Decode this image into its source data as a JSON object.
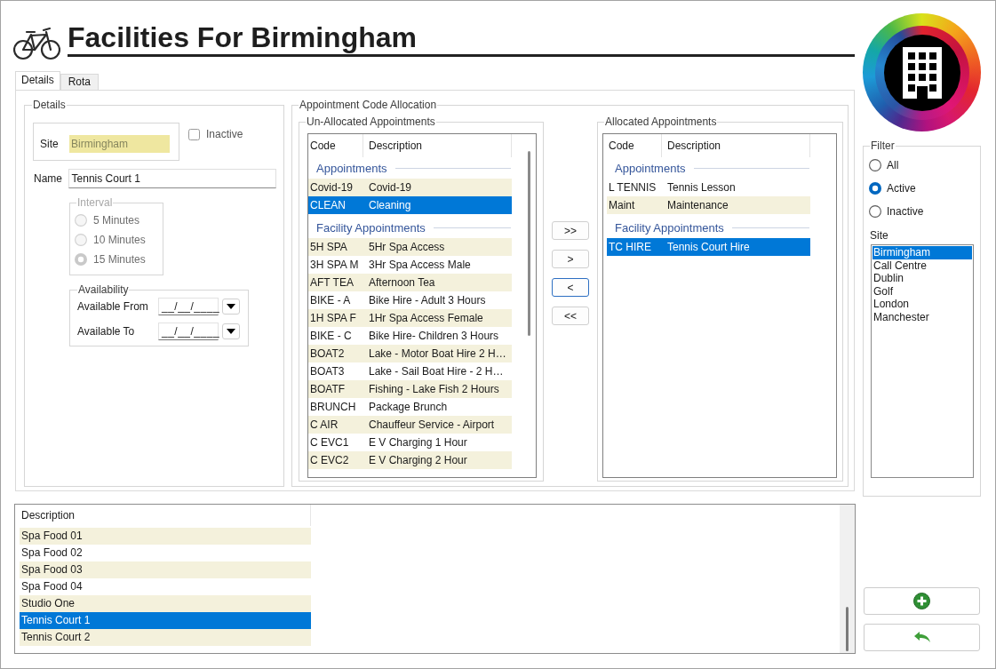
{
  "header": {
    "title": "Facilities For Birmingham"
  },
  "tabs": [
    {
      "label": "Details",
      "selected": true
    },
    {
      "label": "Rota",
      "selected": false
    }
  ],
  "details": {
    "legend": "Details",
    "site": {
      "label": "Site",
      "value": "Birmingham"
    },
    "inactive": {
      "label": "Inactive",
      "checked": false
    },
    "name": {
      "label": "Name",
      "value": "Tennis Court 1"
    },
    "interval": {
      "legend": "Interval",
      "disabled": true,
      "options": [
        {
          "label": "5 Minutes",
          "selected": false
        },
        {
          "label": "10 Minutes",
          "selected": false
        },
        {
          "label": "15 Minutes",
          "selected": true
        }
      ]
    },
    "availability": {
      "legend": "Availability",
      "fields": [
        {
          "label": "Available From",
          "value": "__/__/____"
        },
        {
          "label": "Available To",
          "value": "__/__/____"
        }
      ]
    }
  },
  "allocation": {
    "legend": "Appointment Code Allocation",
    "unallocated": {
      "legend": "Un-Allocated Appointments",
      "columns": [
        "Code",
        "Description"
      ],
      "groups": [
        {
          "title": "Appointments",
          "rows": [
            {
              "code": "Covid-19",
              "description": "Covid-19",
              "shaded": true,
              "selected": false
            },
            {
              "code": "CLEAN",
              "description": "Cleaning",
              "selected": true
            }
          ]
        },
        {
          "title": "Facility Appointments",
          "rows": [
            {
              "code": "5H SPA",
              "description": "5Hr Spa Access",
              "shaded": true,
              "selected": false
            },
            {
              "code": "3H SPA M",
              "description": "3Hr Spa Access Male",
              "shaded": false,
              "selected": false
            },
            {
              "code": "AFT TEA",
              "description": "Afternoon Tea",
              "shaded": true,
              "selected": false
            },
            {
              "code": "BIKE - A",
              "description": "Bike Hire - Adult 3 Hours",
              "shaded": false,
              "selected": false
            },
            {
              "code": "1H SPA F",
              "description": "1Hr Spa Access Female",
              "shaded": true,
              "selected": false
            },
            {
              "code": "BIKE - C",
              "description": "Bike Hire- Children 3 Hours",
              "shaded": false,
              "selected": false
            },
            {
              "code": "BOAT2",
              "description": "Lake - Motor Boat Hire 2 H…",
              "shaded": true,
              "selected": false
            },
            {
              "code": "BOAT3",
              "description": "Lake - Sail Boat Hire - 2 H…",
              "shaded": false,
              "selected": false
            },
            {
              "code": "BOATF",
              "description": "Fishing - Lake Fish 2 Hours",
              "shaded": true,
              "selected": false
            },
            {
              "code": "BRUNCH",
              "description": "Package Brunch",
              "shaded": false,
              "selected": false
            },
            {
              "code": "C AIR",
              "description": "Chauffeur Service - Airport",
              "shaded": true,
              "selected": false
            },
            {
              "code": "C EVC1",
              "description": "E V Charging 1 Hour",
              "shaded": false,
              "selected": false
            },
            {
              "code": "C EVC2",
              "description": "E V Charging 2 Hour",
              "shaded": true,
              "selected": false
            }
          ]
        }
      ]
    },
    "transfer_buttons": [
      {
        "label": ">>",
        "focused": false
      },
      {
        "label": ">",
        "focused": false
      },
      {
        "label": "<",
        "focused": true
      },
      {
        "label": "<<",
        "focused": false
      }
    ],
    "allocated": {
      "legend": "Allocated Appointments",
      "columns": [
        "Code",
        "Description"
      ],
      "groups": [
        {
          "title": "Appointments",
          "rows": [
            {
              "code": "L TENNIS",
              "description": "Tennis Lesson",
              "shaded": false,
              "selected": false
            },
            {
              "code": "Maint",
              "description": "Maintenance",
              "shaded": true,
              "selected": false
            }
          ]
        },
        {
          "title": "Facility Appointments",
          "rows": [
            {
              "code": "TC HIRE",
              "description": "Tennis Court Hire",
              "selected": true
            }
          ]
        }
      ]
    }
  },
  "filter": {
    "legend": "Filter",
    "options": [
      {
        "label": "All",
        "selected": false
      },
      {
        "label": "Active",
        "selected": true
      },
      {
        "label": "Inactive",
        "selected": false
      }
    ],
    "site_label": "Site",
    "sites": [
      {
        "label": "Birmingham",
        "selected": true
      },
      {
        "label": "Call Centre",
        "selected": false
      },
      {
        "label": "Dublin",
        "selected": false
      },
      {
        "label": "Golf",
        "selected": false
      },
      {
        "label": "London",
        "selected": false
      },
      {
        "label": "Manchester",
        "selected": false
      }
    ]
  },
  "facilities": {
    "columns": [
      "Description"
    ],
    "rows": [
      {
        "description": "Spa Food 01",
        "shaded": true,
        "selected": false
      },
      {
        "description": "Spa Food 02",
        "shaded": false,
        "selected": false
      },
      {
        "description": "Spa Food 03",
        "shaded": true,
        "selected": false
      },
      {
        "description": "Spa Food 04",
        "shaded": false,
        "selected": false
      },
      {
        "description": "Studio One",
        "shaded": true,
        "selected": false
      },
      {
        "description": "Tennis Court 1",
        "selected": true
      },
      {
        "description": "Tennis Court 2",
        "shaded": true,
        "selected": false
      }
    ]
  },
  "actions": [
    {
      "kind": "add"
    },
    {
      "kind": "undo"
    }
  ]
}
